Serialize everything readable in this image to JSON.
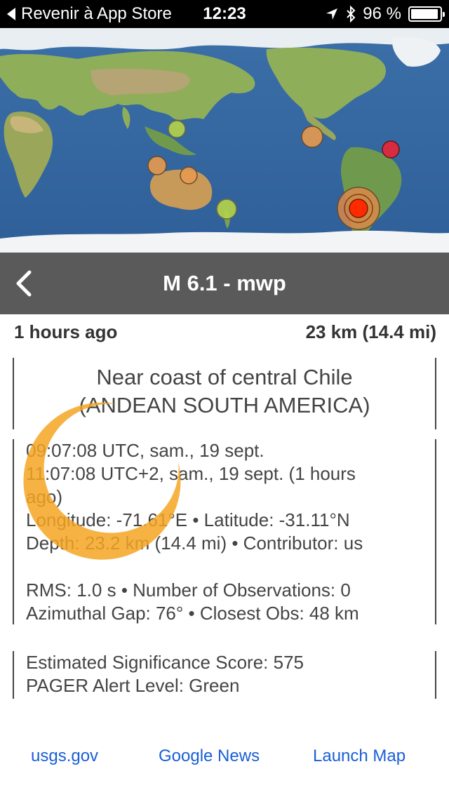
{
  "status_bar": {
    "back_label": "Revenir à App Store",
    "time": "12:23",
    "battery": "96 %",
    "battery_level": 0.96
  },
  "map": {
    "markers": [
      {
        "name": "marker-indonesia-north",
        "color": "#b6d44a"
      },
      {
        "name": "marker-indonesia-west",
        "color": "#e59a4f"
      },
      {
        "name": "marker-new-guinea",
        "color": "#e59a4f"
      },
      {
        "name": "marker-new-zealand",
        "color": "#b6d44a"
      },
      {
        "name": "marker-mexico",
        "color": "#e59a4f"
      },
      {
        "name": "marker-atlantic",
        "color": "#e0293a"
      },
      {
        "name": "marker-chile-selected",
        "color": "#ff2a00"
      }
    ]
  },
  "nav": {
    "title": "M 6.1 - mwp"
  },
  "summary": {
    "time_ago": "1 hours ago",
    "depth": "23 km (14.4 mi)"
  },
  "location": {
    "line1": "Near coast of central Chile",
    "line2": "(ANDEAN SOUTH AMERICA)"
  },
  "details": {
    "utc_time": "09:07:08 UTC, sam., 19 sept.",
    "local_time_line1": "11:07:08 UTC+2, sam., 19 sept. (1 hours",
    "local_time_line2": "ago)",
    "coords": "Longitude: -71.61°E • Latitude: -31.11°N",
    "depth_contrib": "Depth: 23.2 km (14.4 mi) • Contributor: us",
    "rms_obs": "RMS: 1.0 s • Number of Observations: 0",
    "gap_closest": "Azimuthal Gap: 76° • Closest Obs: 48 km"
  },
  "significance": {
    "score": "Estimated Significance Score: 575",
    "pager": "PAGER Alert Level: Green"
  },
  "links": {
    "usgs": "usgs.gov",
    "news": "Google News",
    "map": "Launch Map"
  },
  "colors": {
    "nav_bg": "#5a5a5a",
    "link": "#1a5fd6",
    "spinner": "#f5a623"
  }
}
